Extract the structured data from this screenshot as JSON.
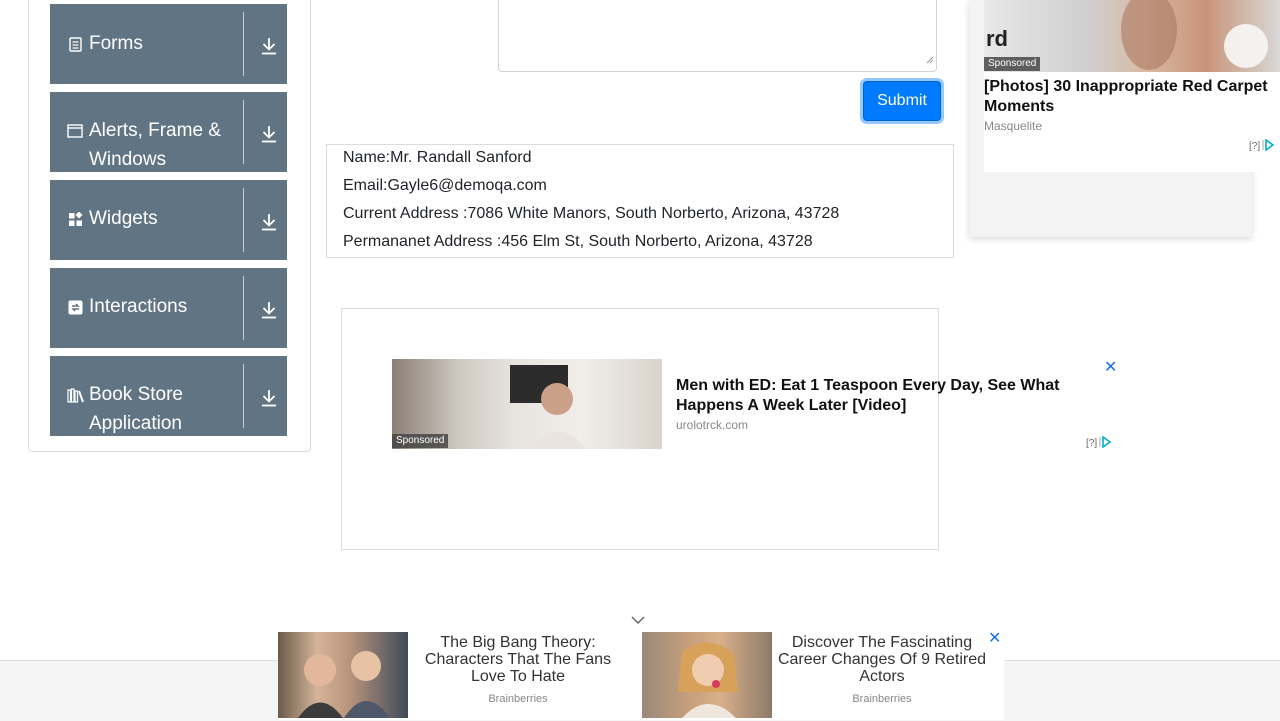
{
  "sidebar": {
    "groups": [
      {
        "label": "Forms",
        "icon": "forms-icon"
      },
      {
        "label": "Alerts, Frame & Windows",
        "icon": "window-icon"
      },
      {
        "label": "Widgets",
        "icon": "widgets-icon"
      },
      {
        "label": "Interactions",
        "icon": "interactions-icon"
      },
      {
        "label": "Book Store Application",
        "icon": "books-icon"
      }
    ]
  },
  "form": {
    "submit_label": "Submit"
  },
  "output": {
    "name": "Name:Mr. Randall Sanford",
    "email": "Email:Gayle6@demoqa.com",
    "current_address": "Current Address :7086 White Manors, South Norberto, Arizona, 43728",
    "permanent_address": "Permananet Address :456 Elm St, South Norberto, Arizona, 43728"
  },
  "ads": {
    "right": {
      "sponsored": "Sponsored",
      "title": "[Photos] 30 Inappropriate Red Carpet Moments",
      "source": "Masquelite",
      "choice": "[?]",
      "image_text": "rd"
    },
    "middle": {
      "sponsored": "Sponsored",
      "title": "Men with ED: Eat 1 Teaspoon Every Day, See What Happens A Week Later [Video]",
      "source": "urolotrck.com",
      "choice": "[?]"
    },
    "bottom": [
      {
        "title": "The Big Bang Theory: Characters That The Fans Love To Hate",
        "source": "Brainberries"
      },
      {
        "title": "Discover The Fascinating Career Changes Of 9 Retired Actors",
        "source": "Brainberries"
      }
    ]
  },
  "colors": {
    "sidebar_group_bg": "#617483",
    "submit_bg": "#007bff",
    "ad_accent": "#1a73e8"
  }
}
